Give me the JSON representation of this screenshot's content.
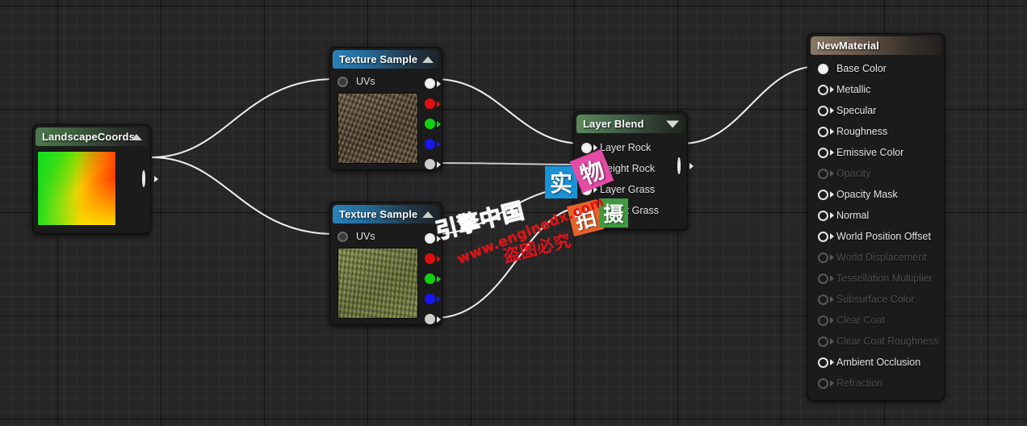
{
  "app": {
    "editor": "Unreal Engine Material Editor"
  },
  "nodes": {
    "landscape_coords": {
      "title": "LandscapeCoords",
      "collapse_icon": "chevron-up-icon",
      "header_color": "#4e7a4e",
      "output_pin_label": ""
    },
    "texture_sample_rock": {
      "title": "Texture Sample",
      "collapse_icon": "chevron-up-icon",
      "header_color": "#2a82b8",
      "input": "UVs",
      "outputs": [
        "",
        "R",
        "G",
        "B",
        "A"
      ],
      "preview": "rock-texture"
    },
    "texture_sample_grass": {
      "title": "Texture Sample",
      "collapse_icon": "chevron-up-icon",
      "header_color": "#2a82b8",
      "input": "UVs",
      "outputs": [
        "",
        "R",
        "G",
        "B",
        "A"
      ],
      "preview": "grass-texture"
    },
    "layer_blend": {
      "title": "Layer Blend",
      "collapse_icon": "chevron-down-icon",
      "header_color": "#5b8a5b",
      "inputs": [
        {
          "label": "Layer Rock",
          "connected": true
        },
        {
          "label": "Height Rock",
          "connected": false
        },
        {
          "label": "Layer Grass",
          "connected": true
        },
        {
          "label": "Height Grass",
          "connected": false
        }
      ],
      "output_pin_label": ""
    },
    "new_material": {
      "title": "NewMaterial",
      "header_color": "#8a7765",
      "inputs": [
        {
          "label": "Base Color",
          "enabled": true,
          "connected": true
        },
        {
          "label": "Metallic",
          "enabled": true,
          "connected": false
        },
        {
          "label": "Specular",
          "enabled": true,
          "connected": false
        },
        {
          "label": "Roughness",
          "enabled": true,
          "connected": false
        },
        {
          "label": "Emissive Color",
          "enabled": true,
          "connected": false
        },
        {
          "label": "Opacity",
          "enabled": false,
          "connected": false
        },
        {
          "label": "Opacity Mask",
          "enabled": true,
          "connected": false
        },
        {
          "label": "Normal",
          "enabled": true,
          "connected": false
        },
        {
          "label": "World Position Offset",
          "enabled": true,
          "connected": false
        },
        {
          "label": "World Displacement",
          "enabled": false,
          "connected": false
        },
        {
          "label": "Tessellation Multiplier",
          "enabled": false,
          "connected": false
        },
        {
          "label": "Subsurface Color",
          "enabled": false,
          "connected": false
        },
        {
          "label": "Clear Coat",
          "enabled": false,
          "connected": false
        },
        {
          "label": "Clear Coat Roughness",
          "enabled": false,
          "connected": false
        },
        {
          "label": "Ambient Occlusion",
          "enabled": true,
          "connected": false
        },
        {
          "label": "Refraction",
          "enabled": false,
          "connected": false
        }
      ]
    }
  },
  "watermark": {
    "brand": "引擎中国",
    "url": "www.enginedx.com",
    "warning": "盗图必究",
    "badges": [
      {
        "char": "实",
        "color": "#1a93d6"
      },
      {
        "char": "物",
        "color": "#e34ba5"
      },
      {
        "char": "拍",
        "color": "#e8622a"
      },
      {
        "char": "摄",
        "color": "#3f9b3f"
      }
    ]
  },
  "wire_color": "#f0f0f0"
}
